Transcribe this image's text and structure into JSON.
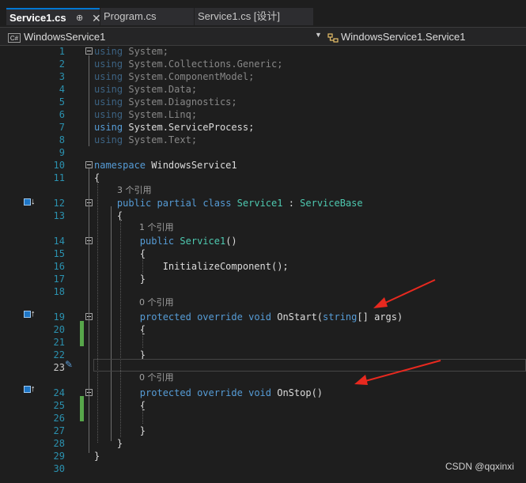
{
  "tabs": [
    {
      "label": "Service1.cs",
      "active": true,
      "pin": "⊕",
      "close": "✕"
    },
    {
      "label": "Program.cs",
      "active": false
    },
    {
      "label": "Service1.cs [设计]",
      "active": false
    }
  ],
  "navbar": {
    "left_icon": "C#",
    "left": "WindowsService1",
    "right": "WindowsService1.Service1"
  },
  "ref_labels": {
    "r3": "3 个引用",
    "r1": "1 个引用",
    "r0a": "0 个引用",
    "r0b": "0 个引用"
  },
  "lines": [
    {
      "n": "1",
      "tokens": [
        [
          "kw",
          "using"
        ],
        [
          "id",
          " System;"
        ]
      ]
    },
    {
      "n": "2",
      "tokens": [
        [
          "kw",
          "using"
        ],
        [
          "id",
          " System.Collections.Generic;"
        ]
      ]
    },
    {
      "n": "3",
      "tokens": [
        [
          "kw",
          "using"
        ],
        [
          "id",
          " System.ComponentModel;"
        ]
      ]
    },
    {
      "n": "4",
      "tokens": [
        [
          "kw",
          "using"
        ],
        [
          "id",
          " System.Data;"
        ]
      ]
    },
    {
      "n": "5",
      "tokens": [
        [
          "kw",
          "using"
        ],
        [
          "id",
          " System.Diagnostics;"
        ]
      ]
    },
    {
      "n": "6",
      "tokens": [
        [
          "kw",
          "using"
        ],
        [
          "id",
          " System.Linq;"
        ]
      ]
    },
    {
      "n": "7",
      "tokens": [
        [
          "kw",
          "using"
        ],
        [
          "id",
          " System.ServiceProcess;"
        ]
      ]
    },
    {
      "n": "8",
      "tokens": [
        [
          "kw",
          "using"
        ],
        [
          "id",
          " System.Text;"
        ]
      ]
    },
    {
      "n": "9",
      "tokens": []
    },
    {
      "n": "10",
      "tokens": [
        [
          "kw",
          "namespace"
        ],
        [
          "id",
          " WindowsService1"
        ]
      ]
    },
    {
      "n": "11",
      "tokens": [
        [
          "id",
          "{"
        ]
      ]
    },
    {
      "n": "12",
      "tokens": [
        [
          "id",
          "    "
        ],
        [
          "kw",
          "public"
        ],
        [
          "id",
          " "
        ],
        [
          "kw",
          "partial"
        ],
        [
          "id",
          " "
        ],
        [
          "kw",
          "class"
        ],
        [
          "id",
          " "
        ],
        [
          "ty",
          "Service1"
        ],
        [
          "id",
          " : "
        ],
        [
          "ty",
          "ServiceBase"
        ]
      ]
    },
    {
      "n": "13",
      "tokens": [
        [
          "id",
          "    {"
        ]
      ]
    },
    {
      "n": "14",
      "tokens": [
        [
          "id",
          "        "
        ],
        [
          "kw",
          "public"
        ],
        [
          "id",
          " "
        ],
        [
          "ty",
          "Service1"
        ],
        [
          "id",
          "()"
        ]
      ]
    },
    {
      "n": "15",
      "tokens": [
        [
          "id",
          "        {"
        ]
      ]
    },
    {
      "n": "16",
      "tokens": [
        [
          "id",
          "            InitializeComponent();"
        ]
      ]
    },
    {
      "n": "17",
      "tokens": [
        [
          "id",
          "        }"
        ]
      ]
    },
    {
      "n": "18",
      "tokens": []
    },
    {
      "n": "19",
      "tokens": [
        [
          "id",
          "        "
        ],
        [
          "kw",
          "protected"
        ],
        [
          "id",
          " "
        ],
        [
          "kw",
          "override"
        ],
        [
          "id",
          " "
        ],
        [
          "kw",
          "void"
        ],
        [
          "id",
          " OnStart("
        ],
        [
          "kw",
          "string"
        ],
        [
          "id",
          "[] args)"
        ]
      ]
    },
    {
      "n": "20",
      "tokens": [
        [
          "id",
          "        {"
        ]
      ]
    },
    {
      "n": "21",
      "tokens": []
    },
    {
      "n": "22",
      "tokens": [
        [
          "id",
          "        }"
        ]
      ]
    },
    {
      "n": "23",
      "tokens": []
    },
    {
      "n": "24",
      "tokens": [
        [
          "id",
          "        "
        ],
        [
          "kw",
          "protected"
        ],
        [
          "id",
          " "
        ],
        [
          "kw",
          "override"
        ],
        [
          "id",
          " "
        ],
        [
          "kw",
          "void"
        ],
        [
          "id",
          " OnStop()"
        ]
      ]
    },
    {
      "n": "25",
      "tokens": [
        [
          "id",
          "        {"
        ]
      ]
    },
    {
      "n": "26",
      "tokens": []
    },
    {
      "n": "27",
      "tokens": [
        [
          "id",
          "        }"
        ]
      ]
    },
    {
      "n": "28",
      "tokens": [
        [
          "id",
          "    }"
        ]
      ]
    },
    {
      "n": "29",
      "tokens": [
        [
          "id",
          "}"
        ]
      ]
    },
    {
      "n": "30",
      "tokens": []
    }
  ],
  "current_line": "23",
  "watermark": "CSDN @qqxinxi",
  "colors": {
    "keyword": "#569cd6",
    "type": "#4ec9b0",
    "line_number": "#2b91af",
    "arrow": "#e8291f",
    "change_bar": "#57a64a"
  },
  "icons": [
    "class-icon",
    "up-arrow-icon",
    "wrench-icon",
    "fold-minus-icon",
    "pin-icon",
    "close-icon",
    "chevron-down-icon"
  ]
}
